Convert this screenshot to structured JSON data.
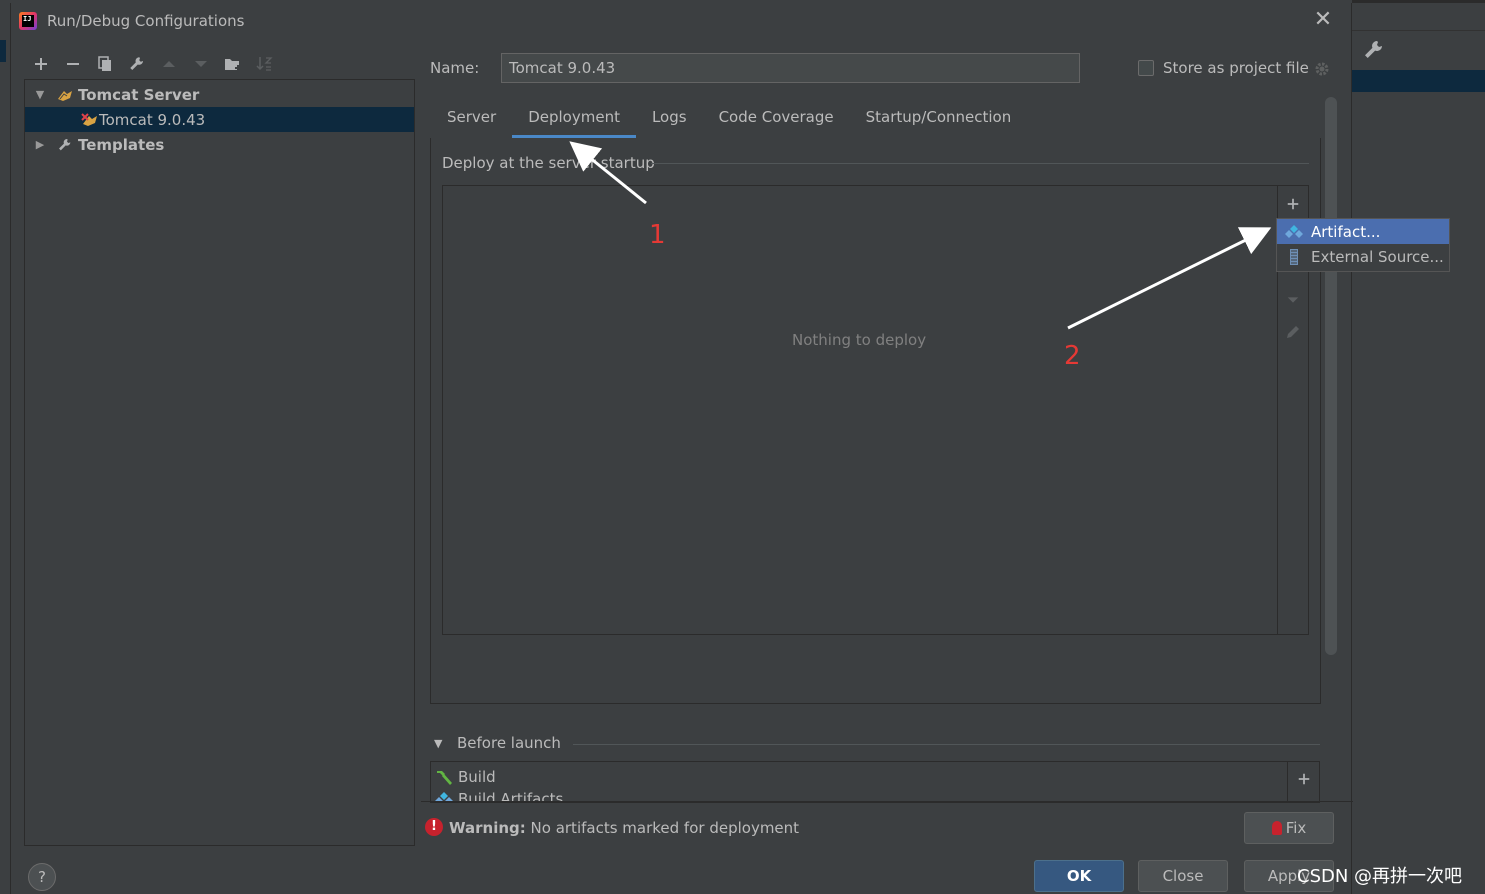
{
  "window": {
    "title": "Run/Debug Configurations",
    "close_glyph": "✕"
  },
  "toolbar": {
    "add": "+",
    "remove": "−"
  },
  "tree": {
    "items": [
      {
        "label": "Tomcat Server",
        "icon": "tomcat-icon"
      },
      {
        "label": "Tomcat 9.0.43",
        "icon": "tomcat-run-icon"
      },
      {
        "label": "Templates",
        "icon": "wrench-icon"
      }
    ]
  },
  "name": {
    "label": "Name:",
    "value": "Tomcat 9.0.43"
  },
  "store": {
    "label": "Store as project file"
  },
  "tabs": [
    {
      "label": "Server"
    },
    {
      "label": "Deployment"
    },
    {
      "label": "Logs"
    },
    {
      "label": "Code Coverage"
    },
    {
      "label": "Startup/Connection"
    }
  ],
  "deployment": {
    "section_title": "Deploy at the server startup",
    "empty_text": "Nothing to deploy",
    "add_glyph": "+"
  },
  "popup": {
    "items": [
      {
        "label": "Artifact...",
        "icon": "artifact-icon"
      },
      {
        "label": "External Source...",
        "icon": "external-source-icon"
      }
    ]
  },
  "before_launch": {
    "title": "Before launch",
    "items": [
      {
        "label": "Build",
        "icon": "hammer-icon"
      },
      {
        "label": "Build Artifacts",
        "icon": "artifact-icon"
      }
    ],
    "add_glyph": "+"
  },
  "warning": {
    "icon_glyph": "!",
    "bold": "Warning:",
    "text": " No artifacts marked for deployment"
  },
  "buttons": {
    "fix": "Fix",
    "ok": "OK",
    "close": "Close",
    "apply": "Apply",
    "help": "?"
  },
  "annotations": {
    "one": "1",
    "two": "2"
  },
  "watermark": "CSDN @再拼一次吧",
  "colors": {
    "background": "#3c3f41",
    "selection": "#0d293e",
    "popup_selection": "#4b6eaf",
    "tab_underline": "#4a88c7",
    "annotation": "#e53935",
    "error": "#c7222d"
  }
}
